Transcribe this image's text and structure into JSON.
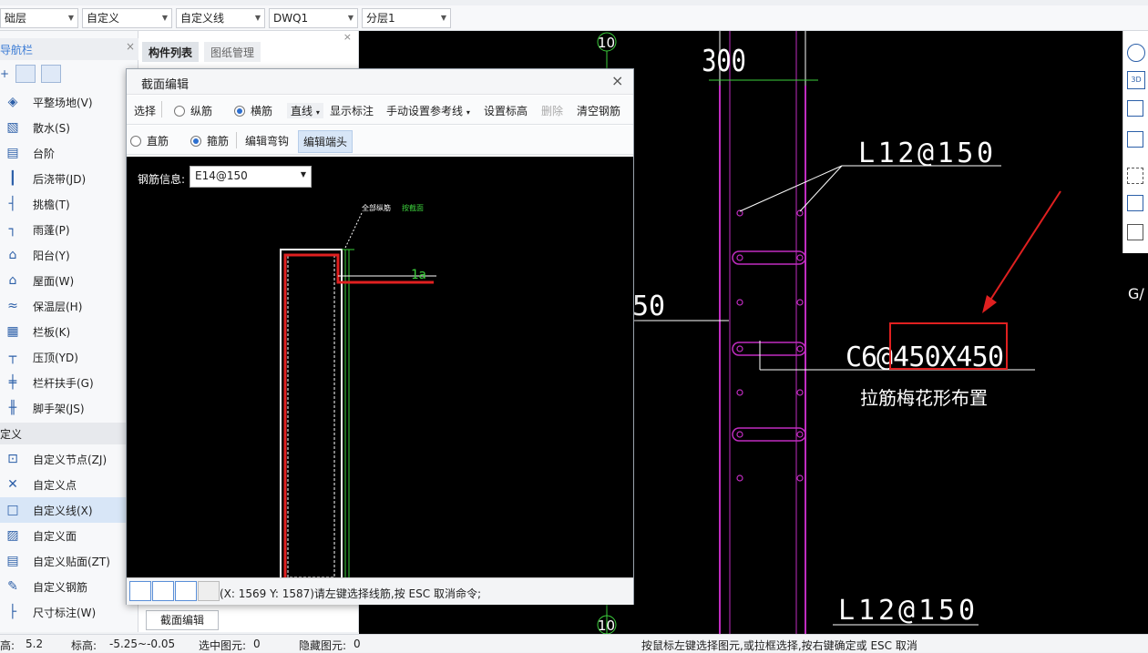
{
  "toolbar": {
    "combos": [
      "础层",
      "自定义",
      "自定义线",
      "DWQ1",
      "分层1"
    ]
  },
  "nav": {
    "title": "导航栏",
    "items": [
      {
        "label": "平整场地(V)",
        "icon": "site-icon"
      },
      {
        "label": "散水(S)",
        "icon": "apron-icon"
      },
      {
        "label": "台阶",
        "icon": "step-icon"
      },
      {
        "label": "后浇带(JD)",
        "icon": "post-pour-icon"
      },
      {
        "label": "挑檐(T)",
        "icon": "eave-icon"
      },
      {
        "label": "雨蓬(P)",
        "icon": "canopy-icon"
      },
      {
        "label": "阳台(Y)",
        "icon": "balcony-icon"
      },
      {
        "label": "屋面(W)",
        "icon": "roof-icon"
      },
      {
        "label": "保温层(H)",
        "icon": "insulation-icon"
      },
      {
        "label": "栏板(K)",
        "icon": "parapet-icon"
      },
      {
        "label": "压顶(YD)",
        "icon": "coping-icon"
      },
      {
        "label": "栏杆扶手(G)",
        "icon": "railing-icon"
      },
      {
        "label": "脚手架(JS)",
        "icon": "scaffold-icon"
      }
    ],
    "section": "定义",
    "custom_items": [
      {
        "label": "自定义节点(ZJ)",
        "icon": "node-icon"
      },
      {
        "label": "自定义点",
        "icon": "point-icon"
      },
      {
        "label": "自定义线(X)",
        "icon": "line-icon"
      },
      {
        "label": "自定义面",
        "icon": "face-icon"
      },
      {
        "label": "自定义贴面(ZT)",
        "icon": "veneer-icon"
      },
      {
        "label": "自定义钢筋",
        "icon": "rebar-icon"
      },
      {
        "label": "尺寸标注(W)",
        "icon": "dimension-icon"
      }
    ]
  },
  "complist": {
    "tabs": [
      "构件列表",
      "图纸管理"
    ],
    "bottom_button": "截面编辑"
  },
  "dialog": {
    "title": "截面编辑",
    "row1": {
      "select": "选择",
      "radio1": "纵筋",
      "radio2": "横筋",
      "line": "直线",
      "show_label": "显示标注",
      "manual_ref": "手动设置参考线",
      "set_elev": "设置标高",
      "delete": "删除",
      "clear": "清空钢筋"
    },
    "row2": {
      "radio1": "直筋",
      "radio2": "箍筋",
      "edit_hook": "编辑弯钩",
      "edit_end": "编辑端头"
    },
    "rebar_info_label": "钢筋信息:",
    "rebar_info_value": "E14@150",
    "canvas_label1": "全部纵筋",
    "canvas_label2": "按截面",
    "canvas_la": "1a",
    "status_text": "(X: 1569 Y: 1587)请左键选择线筋,按 ESC 取消命令;"
  },
  "cad": {
    "axis_top": "10",
    "axis_bottom": "10",
    "dim_300": "300",
    "label_l12_top": "L12@150",
    "label_c6": "C6@",
    "label_c6_boxed": "450X450",
    "label_note": "拉筋梅花形布置",
    "label_l12_bottom": "L12@150",
    "label_50": "50",
    "label_g": "G/",
    "colors": {
      "magenta": "#c02cc0",
      "white": "#ffffff",
      "red": "#e02020",
      "green": "#3ccf3c"
    }
  },
  "statusbar": {
    "height_label": "高:",
    "height_value": "5.2",
    "elev_label": "标高:",
    "elev_value": "-5.25~-0.05",
    "selected_label": "选中图元:",
    "selected_value": "0",
    "hidden_label": "隐藏图元:",
    "hidden_value": "0",
    "hint": "按鼠标左键选择图元,或拉框选择,按右键确定或 ESC 取消"
  }
}
